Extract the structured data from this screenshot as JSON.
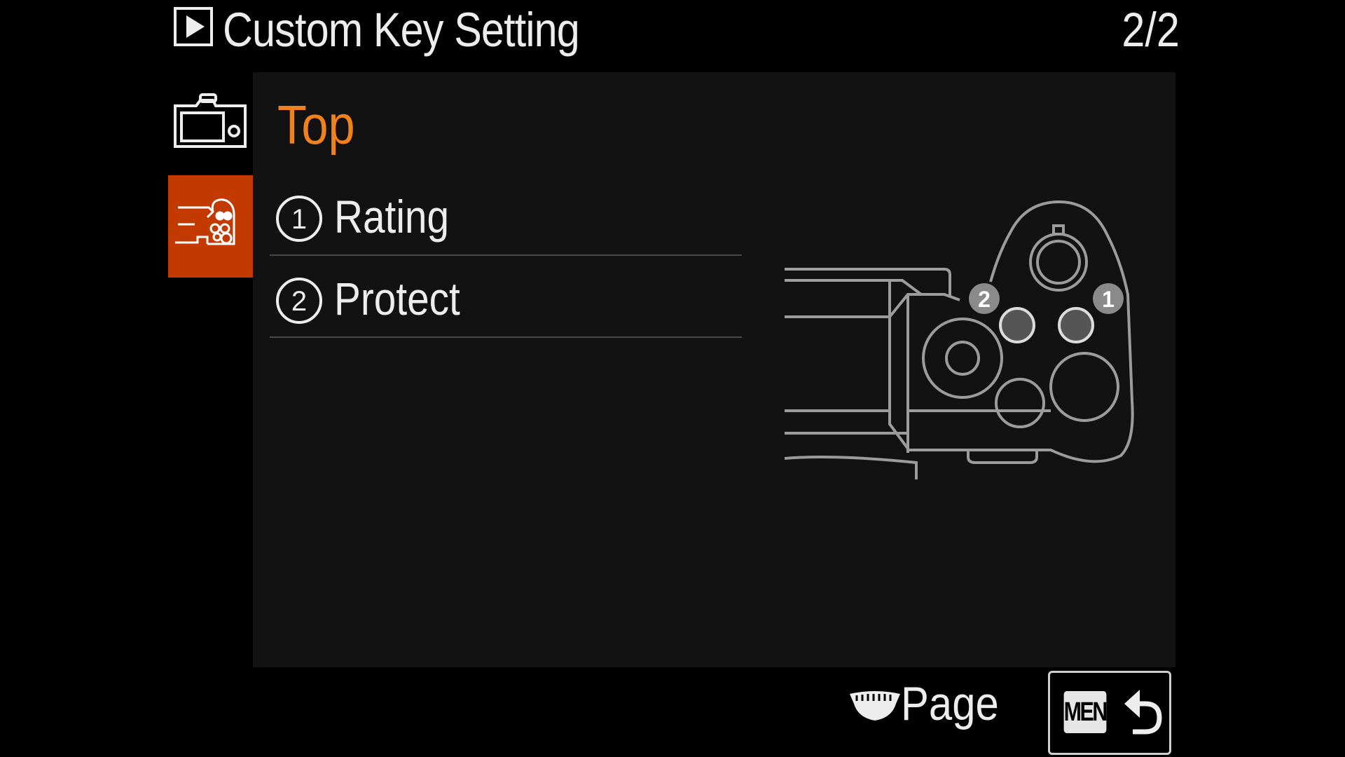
{
  "header": {
    "title": "Custom Key Setting",
    "page_indicator": "2/2",
    "icon": "playback-icon"
  },
  "sidebar": {
    "tabs": [
      {
        "id": "camera-body",
        "icon": "camera-body-icon",
        "selected": false
      },
      {
        "id": "camera-top",
        "icon": "camera-top-icon",
        "selected": true
      }
    ]
  },
  "main": {
    "section_title": "Top",
    "items": [
      {
        "number": "1",
        "label": "Rating"
      },
      {
        "number": "2",
        "label": "Protect"
      }
    ],
    "diagram": {
      "icon": "camera-top-diagram",
      "button_labels": [
        "2",
        "1"
      ]
    }
  },
  "footer": {
    "page_label": "Page",
    "page_icon": "control-dial-icon",
    "menu_badge": "MENU",
    "back_icon": "return-arrow-icon"
  },
  "colors": {
    "background": "#000000",
    "panel": "#121212",
    "accent": "#f0821e",
    "selected_tab": "#c23a00",
    "text": "#ededed"
  }
}
